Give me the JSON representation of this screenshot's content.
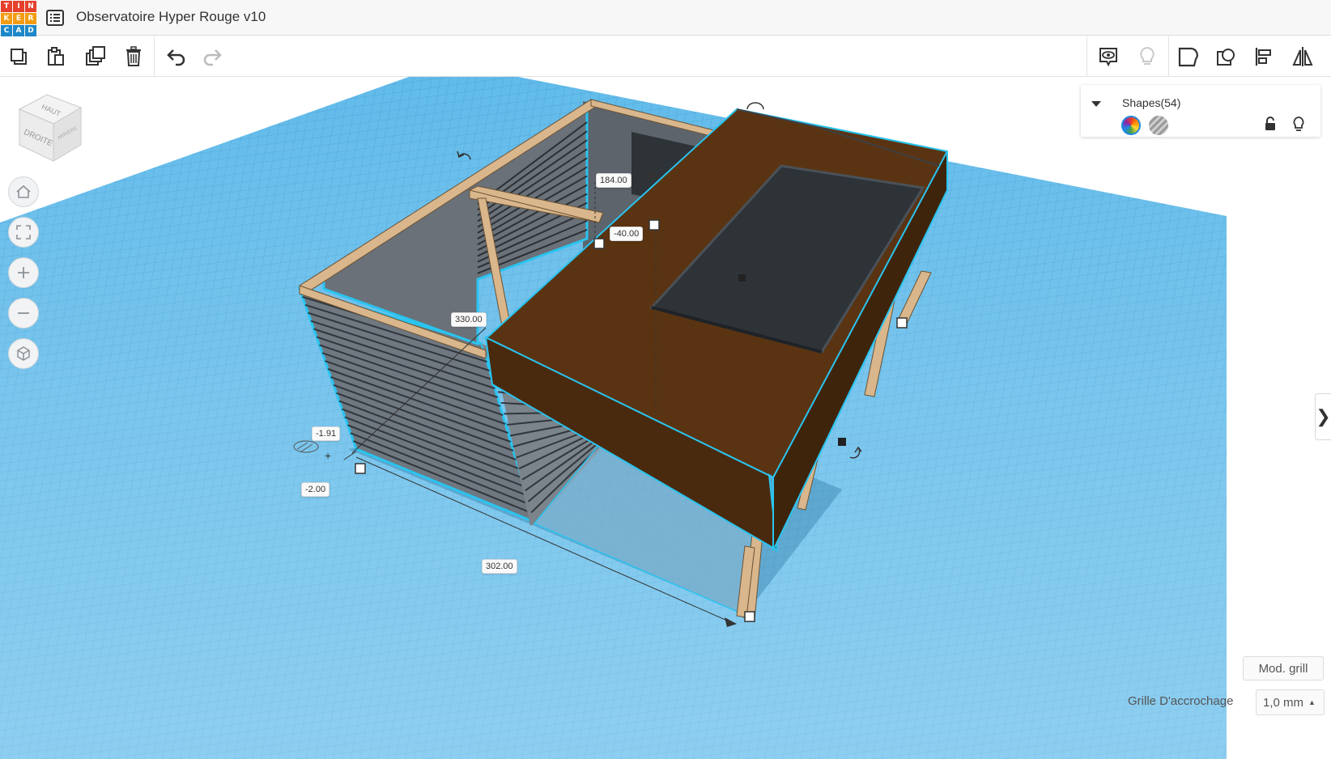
{
  "app": {
    "logo_letters": [
      "T",
      "I",
      "N",
      "K",
      "E",
      "R",
      "C",
      "A",
      "D"
    ],
    "logo_colors": [
      "#e5412d",
      "#e5412d",
      "#e5412d",
      "#f39c12",
      "#f39c12",
      "#f39c12",
      "#1e88c9",
      "#1e88c9",
      "#1e88c9"
    ],
    "menu_icon": "list-icon",
    "title": "Observatoire Hyper Rouge v10"
  },
  "toolbar": {
    "left_tools": [
      {
        "name": "copy",
        "icon": "copy-icon"
      },
      {
        "name": "paste",
        "icon": "paste-icon"
      },
      {
        "name": "duplicate",
        "icon": "duplicate-icon"
      },
      {
        "name": "delete",
        "icon": "trash-icon"
      },
      {
        "name": "undo",
        "icon": "undo-icon"
      },
      {
        "name": "redo",
        "icon": "redo-icon"
      }
    ],
    "right_tools": [
      {
        "name": "show-all",
        "icon": "eye-icon"
      },
      {
        "name": "hide",
        "icon": "lightbulb-icon"
      },
      {
        "name": "group",
        "icon": "group-icon"
      },
      {
        "name": "ungroup",
        "icon": "ungroup-icon"
      },
      {
        "name": "align",
        "icon": "align-icon"
      },
      {
        "name": "mirror",
        "icon": "mirror-icon"
      }
    ]
  },
  "viewcube": {
    "top_face": "HAUT",
    "front_face": "DROITE",
    "side_face": "ARRIÈRE"
  },
  "nav": [
    {
      "name": "home",
      "icon": "home-icon"
    },
    {
      "name": "fit",
      "icon": "fit-view-icon"
    },
    {
      "name": "zoom-in",
      "icon": "plus-icon"
    },
    {
      "name": "zoom-out",
      "icon": "minus-icon"
    },
    {
      "name": "perspective",
      "icon": "cube-icon"
    }
  ],
  "shapes_panel": {
    "title": "Shapes(54)",
    "solid_icon": "rainbow-color-icon",
    "hole_icon": "hole-stripes-icon"
  },
  "dimensions": {
    "height": "184.00",
    "elevation": "-40.00",
    "depth": "330.00",
    "x_offset": "-1.91",
    "y_offset": "-2.00",
    "width": "302.00"
  },
  "scene_colors": {
    "grid": "#5ab6e6",
    "grid_line": "#3f9fd4",
    "roof": "#5a3412",
    "solar_panel": "#2e3338",
    "wall": "#6f7780",
    "beam": "#d9b68c",
    "selection": "#29c4f0"
  },
  "bottom": {
    "mod_grid": "Mod. grill",
    "snap_label": "Grille D'accrochage",
    "snap_value": "1,0 mm"
  }
}
